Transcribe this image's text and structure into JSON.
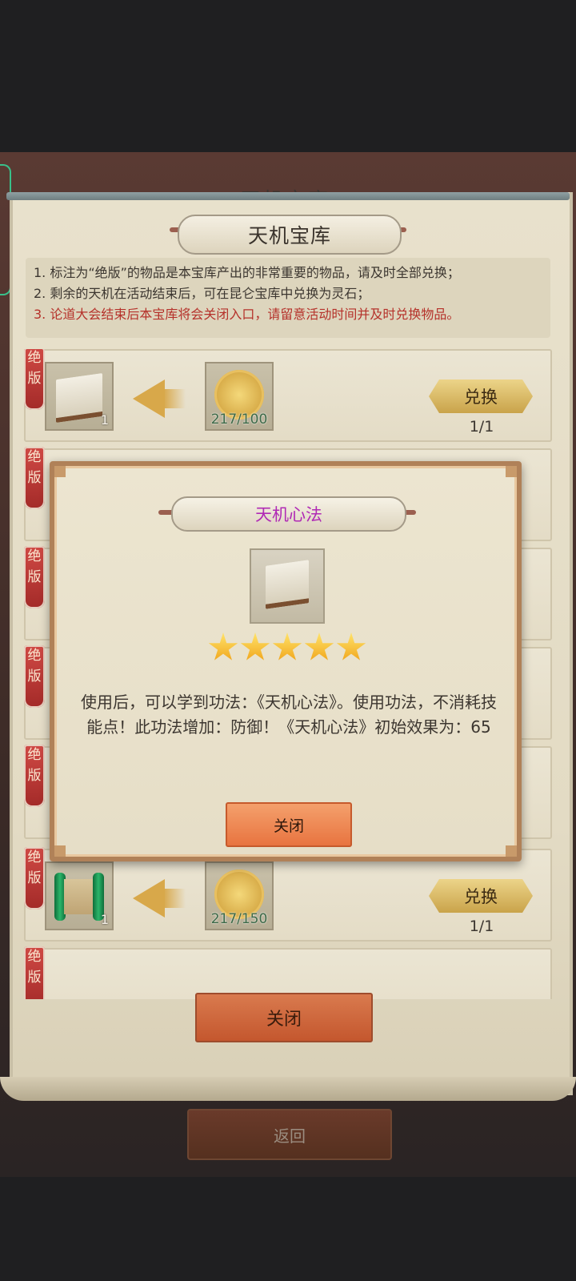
{
  "background": {
    "title_partial": "天机宝库",
    "back_label": "返回"
  },
  "panel": {
    "title": "天机宝库",
    "notices": [
      "1. 标注为“绝版”的物品是本宝库产出的非常重要的物品，请及时全部兑换；",
      "2. 剩余的天机在活动结束后，可在昆仑宝库中兑换为灵石；",
      "3. 论道大会结束后本宝库将会关闭入口，请留意活动时间并及时兑换物品。"
    ],
    "rows": [
      {
        "ribbon": "绝版",
        "item_icon": "book-icon",
        "item_count": "1",
        "cost": "217/100",
        "button": "兑换",
        "limit": "1/1"
      },
      {
        "ribbon": "绝版",
        "item_icon": "scroll-icon",
        "item_count": "1",
        "cost": "217/150",
        "button": "兑换",
        "limit": "1/1"
      }
    ],
    "hidden_ribbon": "绝版",
    "close_label": "关闭"
  },
  "modal": {
    "title": "天机心法",
    "item_icon": "book-icon",
    "stars": 5,
    "description": "使用后，可以学到功法：《天机心法》。使用功法，不消耗技能点！此功法增加：防御！《天机心法》初始效果为：65",
    "close_label": "关闭"
  },
  "colors": {
    "modal_title": "#b02ab5",
    "notice_red": "#b5312a",
    "exchange_gold": "#c9a34a",
    "close_orange": "#e87440"
  }
}
